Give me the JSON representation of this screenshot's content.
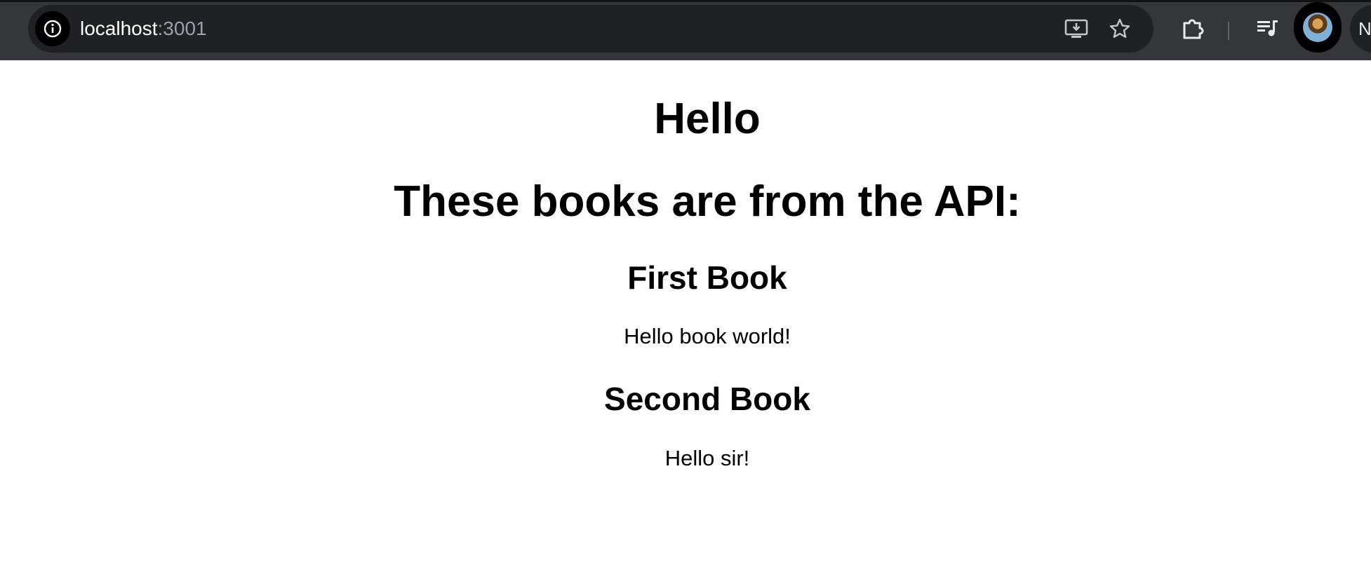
{
  "browser": {
    "url_host": "localhost",
    "url_port": ":3001",
    "profile_initial": "N"
  },
  "page": {
    "heading": "Hello",
    "subheading": "These books are from the API:",
    "books": [
      {
        "title": "First Book",
        "text": "Hello book world!"
      },
      {
        "title": "Second Book",
        "text": "Hello sir!"
      }
    ]
  }
}
